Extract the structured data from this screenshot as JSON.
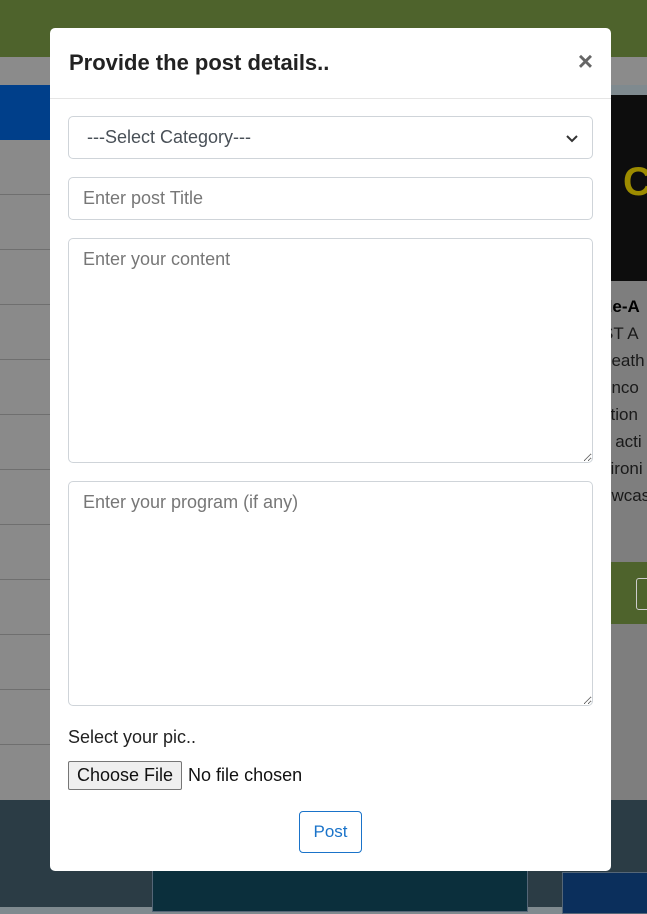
{
  "background": {
    "card_title": "de-A",
    "card_lines": [
      "ST A",
      "death",
      "enco",
      "ction",
      "s acti",
      "vironi",
      "owcas"
    ],
    "card_image_text": "C"
  },
  "modal": {
    "title": "Provide the post details..",
    "close_glyph": "×",
    "category": {
      "selected": "---Select Category---"
    },
    "title_field": {
      "placeholder": "Enter post Title"
    },
    "content_field": {
      "placeholder": "Enter your content"
    },
    "program_field": {
      "placeholder": "Enter your program (if any)"
    },
    "pic_label": "Select your pic..",
    "file": {
      "button": "Choose File",
      "status": "No file chosen"
    },
    "submit": "Post"
  },
  "colors": {
    "header_bar": "#4e632c",
    "accent": "#1a73c9",
    "overlay": "#7f8a8f"
  }
}
